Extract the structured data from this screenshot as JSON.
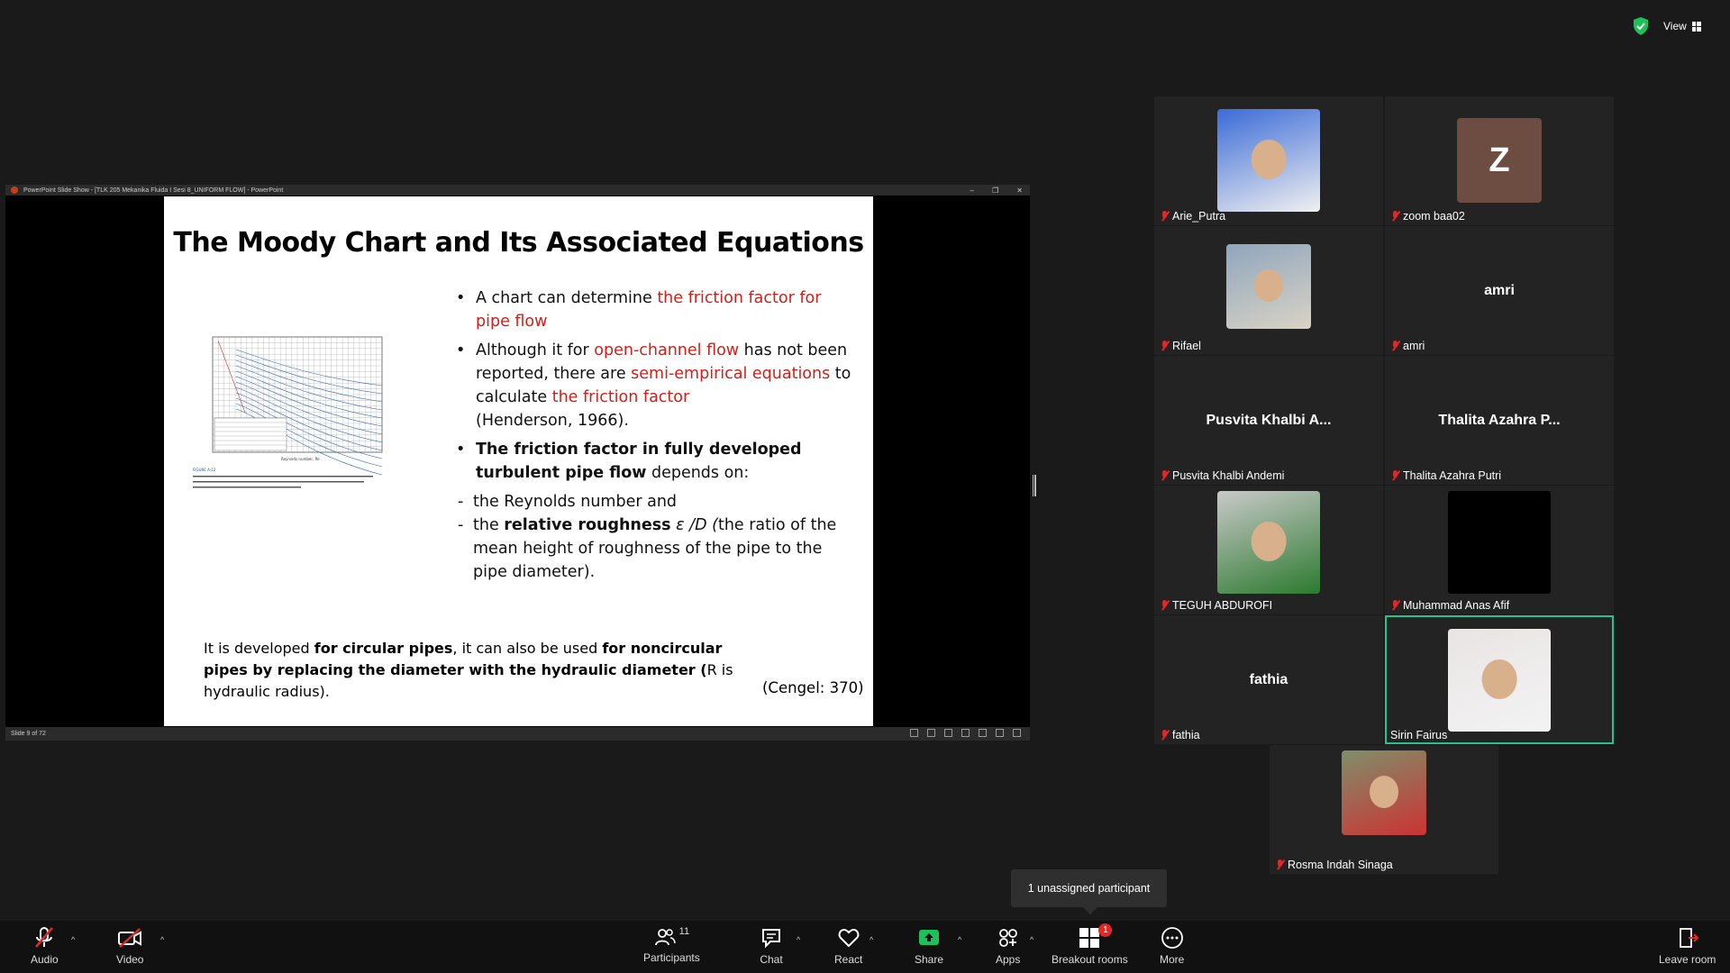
{
  "top_right": {
    "view_label": "View"
  },
  "ppt": {
    "window_title": "PowerPoint Slide Show - [TLK 205 Mekanika Fluida I Sesi 8_UNIFORM FLOW] - PowerPoint",
    "slide_status": "Slide 9 of 72",
    "slide": {
      "title": "The Moody Chart and Its Associated Equations",
      "b1_a": "A chart can determine ",
      "b1_b": "the friction factor for pipe flow",
      "b2_a": "Although it for ",
      "b2_b": "open-channel flow",
      "b2_c": " has not been reported, there are ",
      "b2_d": "semi-empirical equations",
      "b2_e": " to calculate ",
      "b2_f": "the friction factor",
      "b2_g": "(Henderson, 1966).",
      "b3_a": "The friction factor in fully developed turbulent pipe flow",
      "b3_b": " depends on:",
      "s1": "the Reynolds number and",
      "s2_a": "the ",
      "s2_b": "relative roughness",
      "s2_c": " ε /D (",
      "s2_d": "the ratio of the mean height of roughness of the pipe to the pipe diameter).",
      "f_a": "It is developed ",
      "f_b": "for circular pipes",
      "f_c": ", it can also be used ",
      "f_d": "for noncircular pipes by replacing the diameter with the hydraulic diameter (",
      "f_e": "R is hydraulic radius).",
      "citation": "(Cengel: 370)",
      "fig_caption": "FIGURE A-12",
      "fig_xlabel": "Reynolds number, Re"
    }
  },
  "participants": [
    {
      "name": "Arie_Putra",
      "type": "photo"
    },
    {
      "name": "zoom baa02",
      "type": "initial",
      "initial": "Z"
    },
    {
      "name": "Rifael",
      "type": "photo"
    },
    {
      "name": "amri",
      "type": "name",
      "display": "amri"
    },
    {
      "name": "Pusvita Khalbi Andemi",
      "type": "name",
      "display": "Pusvita Khalbi A..."
    },
    {
      "name": "Thalita Azahra Putri",
      "type": "name",
      "display": "Thalita Azahra P..."
    },
    {
      "name": "TEGUH ABDUROFI",
      "type": "photo"
    },
    {
      "name": "Muhammad Anas Afif",
      "type": "video"
    },
    {
      "name": "fathia",
      "type": "name",
      "display": "fathia"
    },
    {
      "name": "Sirin Fairus",
      "type": "photo",
      "active": true
    },
    {
      "name": "Rosma Indah Sinaga",
      "type": "photo"
    }
  ],
  "tooltip": "1 unassigned participant",
  "toolbar": {
    "audio": "Audio",
    "video": "Video",
    "participants": "Participants",
    "participants_count": "11",
    "chat": "Chat",
    "react": "React",
    "share": "Share",
    "apps": "Apps",
    "breakout": "Breakout rooms",
    "breakout_badge": "1",
    "more": "More",
    "leave": "Leave room"
  },
  "colors": {
    "active_border": "#28c28f",
    "muted": "#e02828",
    "slide_red": "#d0201a",
    "share_green": "#1ec05a"
  }
}
